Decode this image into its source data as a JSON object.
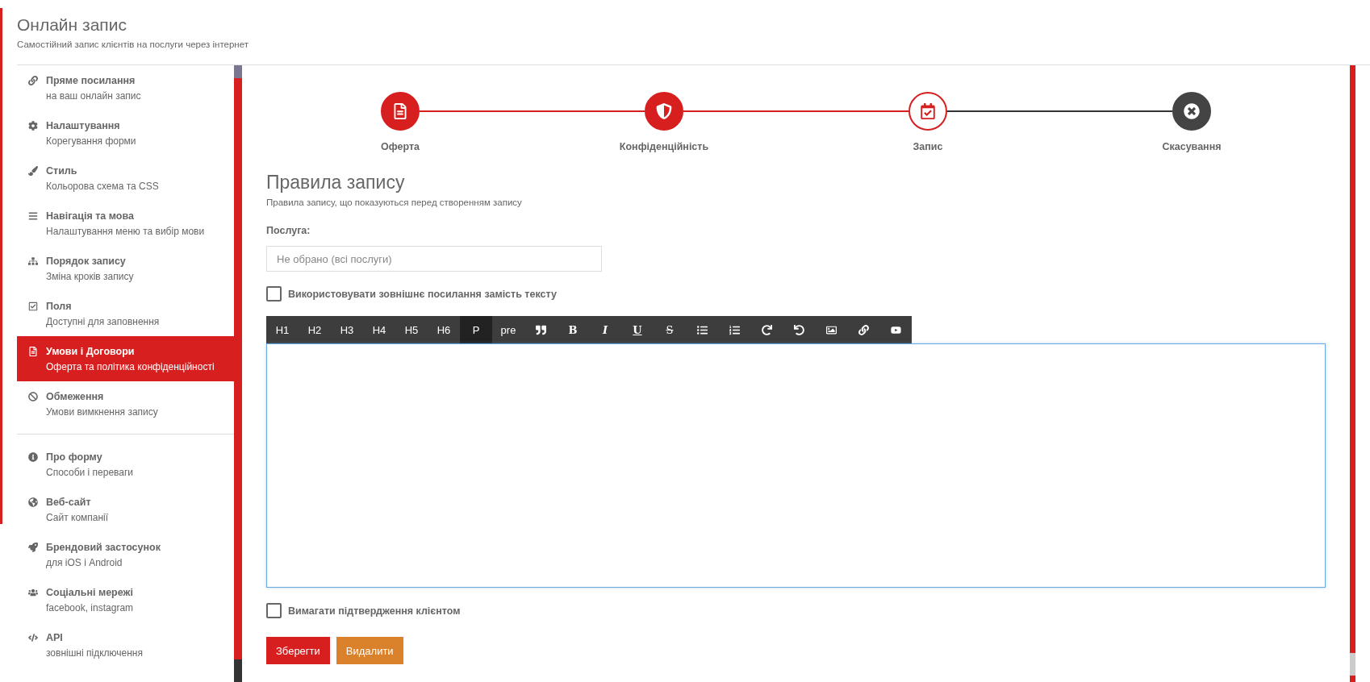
{
  "header": {
    "title": "Онлайн запис",
    "subtitle": "Самостійний запис клієнтів на послуги через інтернет"
  },
  "sidebar": {
    "groups": [
      {
        "items": [
          {
            "title": "Пряме посилання",
            "subtitle": "на ваш онлайн запис",
            "selected": false
          },
          {
            "title": "Налаштування",
            "subtitle": "Корегування форми",
            "selected": false
          },
          {
            "title": "Стиль",
            "subtitle": "Кольорова схема та CSS",
            "selected": false
          },
          {
            "title": "Навігація та мова",
            "subtitle": "Налаштування меню та вибір мови",
            "selected": false
          },
          {
            "title": "Порядок запису",
            "subtitle": "Зміна кроків запису",
            "selected": false
          },
          {
            "title": "Поля",
            "subtitle": "Доступні для заповнення",
            "selected": false
          },
          {
            "title": "Умови і Договори",
            "subtitle": "Оферта та політика конфіденційності",
            "selected": true
          },
          {
            "title": "Обмеження",
            "subtitle": "Умови вимкнення запису",
            "selected": false
          }
        ]
      },
      {
        "items": [
          {
            "title": "Про форму",
            "subtitle": "Способи і переваги",
            "selected": false
          },
          {
            "title": "Веб-сайт",
            "subtitle": "Сайт компанії",
            "selected": false
          },
          {
            "title": "Брендовий застосунок",
            "subtitle": "для iOS і Android",
            "selected": false
          },
          {
            "title": "Соціальні мережі",
            "subtitle": "facebook, instagram",
            "selected": false
          },
          {
            "title": "API",
            "subtitle": "зовнішні підключення",
            "selected": false
          }
        ]
      }
    ]
  },
  "stepper": [
    {
      "label": "Оферта",
      "selected": false
    },
    {
      "label": "Конфіденційність",
      "selected": false
    },
    {
      "label": "Запис",
      "selected": true
    },
    {
      "label": "Скасування",
      "selected": false
    }
  ],
  "form": {
    "title": "Правила запису",
    "subtitle": "Правила запису, що показуються перед створенням запису",
    "service": {
      "label": "Послуга:",
      "placeholder": "Не обрано (всі послуги)"
    },
    "external_link": {
      "label": "Використовувати зовнішнє посилання замість тексту",
      "checked": false
    },
    "toolbar": [
      {
        "kind": "heading",
        "label": "H1",
        "selected": false
      },
      {
        "kind": "heading",
        "label": "H2",
        "selected": false
      },
      {
        "kind": "heading",
        "label": "H3",
        "selected": false
      },
      {
        "kind": "heading",
        "label": "H4",
        "selected": false
      },
      {
        "kind": "heading",
        "label": "H5",
        "selected": false
      },
      {
        "kind": "heading",
        "label": "H6",
        "selected": false
      },
      {
        "kind": "heading",
        "label": "P",
        "selected": true
      },
      {
        "kind": "heading",
        "label": "pre",
        "selected": false
      },
      {
        "kind": "quote",
        "selected": false
      },
      {
        "kind": "bold",
        "label": "B",
        "selected": false
      },
      {
        "kind": "italic",
        "label": "I",
        "selected": false
      },
      {
        "kind": "underline",
        "label": "U",
        "selected": false
      },
      {
        "kind": "strike",
        "label": "S",
        "selected": false
      },
      {
        "kind": "bullets",
        "selected": false
      },
      {
        "kind": "numbers",
        "selected": false
      },
      {
        "kind": "redo",
        "selected": false
      },
      {
        "kind": "undo",
        "selected": false
      },
      {
        "kind": "image",
        "selected": false
      },
      {
        "kind": "link",
        "selected": false
      },
      {
        "kind": "video",
        "selected": false
      }
    ],
    "editor": {
      "focused": true
    },
    "confirm": {
      "label": "Вимагати підтвердження клієнтом",
      "checked": false
    },
    "buttons": [
      {
        "kind": "primary",
        "label": "Зберегти"
      },
      {
        "kind": "danger",
        "label": "Видалити"
      }
    ]
  }
}
